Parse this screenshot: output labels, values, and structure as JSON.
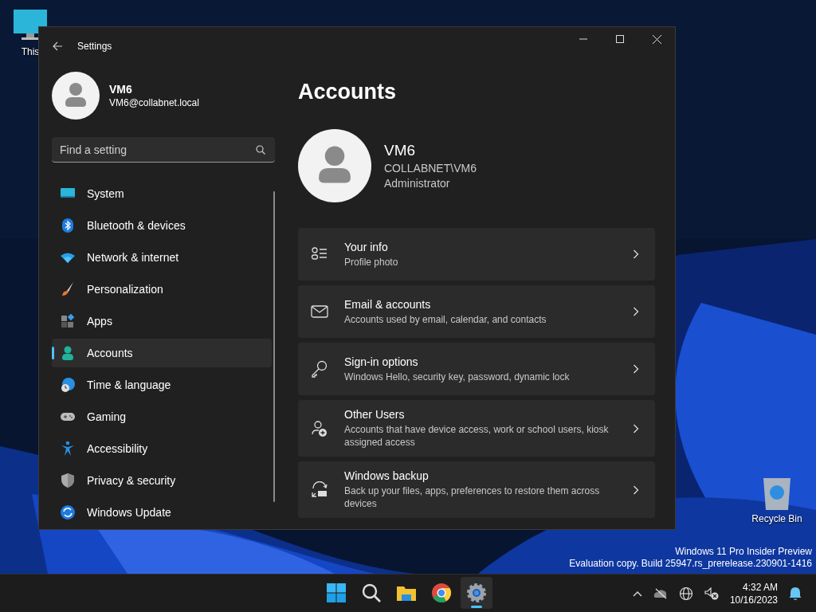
{
  "desktop": {
    "icons": [
      {
        "kind": "pc",
        "label": "This"
      },
      {
        "kind": "recycle",
        "label": "Recycle Bin"
      }
    ],
    "build_info": [
      "Windows 11 Pro Insider Preview",
      "Evaluation copy. Build 25947.rs_prerelease.230901-1416"
    ]
  },
  "window": {
    "title": "Settings"
  },
  "profile": {
    "name": "VM6",
    "email": "VM6@collabnet.local"
  },
  "search": {
    "placeholder": "Find a setting"
  },
  "nav": [
    {
      "kind": "system",
      "label": "System",
      "selected": false
    },
    {
      "kind": "bluetooth",
      "label": "Bluetooth & devices",
      "selected": false
    },
    {
      "kind": "network",
      "label": "Network & internet",
      "selected": false
    },
    {
      "kind": "personalization",
      "label": "Personalization",
      "selected": false
    },
    {
      "kind": "apps",
      "label": "Apps",
      "selected": false
    },
    {
      "kind": "accounts",
      "label": "Accounts",
      "selected": true
    },
    {
      "kind": "time",
      "label": "Time & language",
      "selected": false
    },
    {
      "kind": "gaming",
      "label": "Gaming",
      "selected": false
    },
    {
      "kind": "accessibility",
      "label": "Accessibility",
      "selected": false
    },
    {
      "kind": "privacy",
      "label": "Privacy & security",
      "selected": false
    },
    {
      "kind": "update",
      "label": "Windows Update",
      "selected": false
    }
  ],
  "page": {
    "title": "Accounts",
    "user": {
      "name": "VM6",
      "domain": "COLLABNET\\VM6",
      "role": "Administrator"
    }
  },
  "cards": [
    {
      "kind": "info",
      "title": "Your info",
      "subtitle": "Profile photo"
    },
    {
      "kind": "email",
      "title": "Email & accounts",
      "subtitle": "Accounts used by email, calendar, and contacts"
    },
    {
      "kind": "signin",
      "title": "Sign-in options",
      "subtitle": "Windows Hello, security key, password, dynamic lock"
    },
    {
      "kind": "users",
      "title": "Other Users",
      "subtitle": "Accounts that have device access, work or school users, kiosk assigned access"
    },
    {
      "kind": "backup",
      "title": "Windows backup",
      "subtitle": "Back up your files, apps, preferences to restore them across devices"
    }
  ],
  "taskbar": {
    "apps": [
      {
        "kind": "start",
        "selected": false
      },
      {
        "kind": "search",
        "selected": false
      },
      {
        "kind": "explorer",
        "selected": false
      },
      {
        "kind": "browser",
        "selected": false
      },
      {
        "kind": "settings",
        "selected": true
      }
    ],
    "time": "4:32 AM",
    "date": "10/16/2023"
  }
}
